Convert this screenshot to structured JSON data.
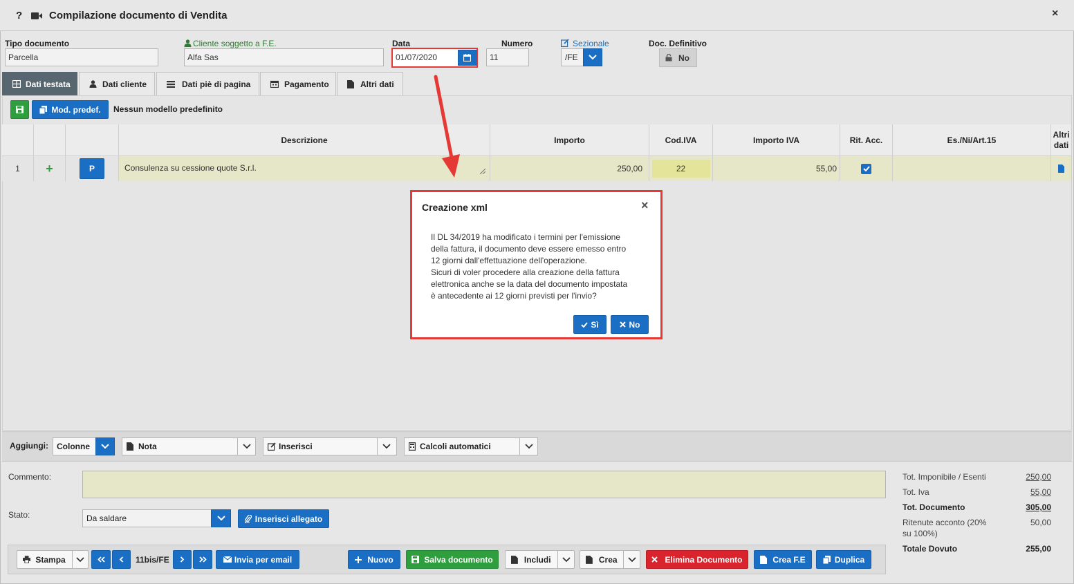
{
  "window": {
    "title": "Compilazione documento di Vendita",
    "help_label": "?",
    "close_label": "×"
  },
  "header": {
    "tipo_label": "Tipo documento",
    "tipo_value": "Parcella",
    "cliente_label": "Cliente soggetto a F.E.",
    "cliente_value": "Alfa Sas",
    "data_label": "Data",
    "data_value": "01/07/2020",
    "numero_label": "Numero",
    "numero_value": "11",
    "sezionale_label": "Sezionale",
    "sezionale_value": "/FE",
    "definitivo_label": "Doc. Definitivo",
    "definitivo_value": "No"
  },
  "tabs": [
    {
      "label": "Dati testata"
    },
    {
      "label": "Dati cliente"
    },
    {
      "label": "Dati piè di pagina"
    },
    {
      "label": "Pagamento"
    },
    {
      "label": "Altri dati"
    }
  ],
  "toolbar": {
    "mod_label": "Mod. predef.",
    "mod_status": "Nessun modello predefinito"
  },
  "grid": {
    "headers": [
      "Descrizione",
      "Importo",
      "Cod.IVA",
      "Importo IVA",
      "Rit. Acc.",
      "Es./Ni/Art.15",
      "Altri dati"
    ],
    "headers_altri_1": "Altri",
    "headers_altri_2": "dati",
    "row": {
      "num": "1",
      "add": "+",
      "p": "P",
      "descrizione": "Consulenza su cessione quote S.r.l.",
      "importo": "250,00",
      "cod_iva": "22",
      "importo_iva": "55,00"
    }
  },
  "modal": {
    "title": "Creazione xml",
    "close": "×",
    "lines": [
      "Il DL 34/2019 ha modificato i termini per l'emissione",
      "della fattura, il documento deve essere emesso entro",
      "12 giorni dall'effettuazione dell'operazione.",
      "Sicuri di voler procedere alla creazione della fattura",
      "elettronica anche se la data del documento impostata",
      "è antecedente ai 12 giorni previsti per l'invio?"
    ],
    "yes_label": "Sì",
    "no_label": "No"
  },
  "aggiungi": {
    "label": "Aggiungi:",
    "colonne": "Colonne",
    "nota": "Nota",
    "inserisci": "Inserisci",
    "calcoli": "Calcoli automatici"
  },
  "footer": {
    "commento_label": "Commento:",
    "stato_label": "Stato:",
    "stato_value": "Da saldare",
    "allegato_label": "Inserisci allegato"
  },
  "totals": [
    {
      "label": "Tot. Imponibile / Esenti",
      "value": "250,00"
    },
    {
      "label": "Tot. Iva",
      "value": "55,00"
    },
    {
      "label": "Tot. Documento",
      "value": "305,00"
    },
    {
      "label": "Ritenute acconto (20%",
      "label2": "su 100%)",
      "value": "50,00"
    },
    {
      "label": "Totale Dovuto",
      "value": "255,00"
    }
  ],
  "actions": {
    "stampa": "Stampa",
    "doc_num": "11bis/FE",
    "email": "Invia per email",
    "nuovo": "Nuovo",
    "salva": "Salva documento",
    "includi": "Includi",
    "crea": "Crea",
    "elimina": "Elimina Documento",
    "crea_fe": "Crea F.E",
    "duplica": "Duplica"
  }
}
